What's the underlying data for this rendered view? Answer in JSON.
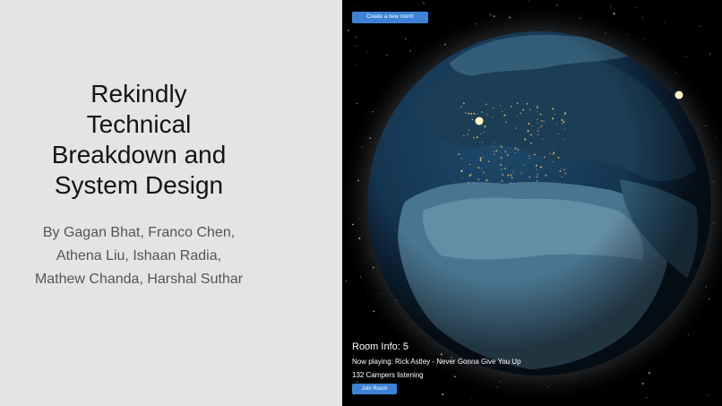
{
  "slide": {
    "title": "Rekindly\nTechnical\nBreakdown and\nSystem Design",
    "authors": "By Gagan Bhat, Franco Chen,\nAthena Liu, Ishaan Radia,\nMathew Chanda, Harshal Suthar"
  },
  "app": {
    "create_room_label": "Create a new room!",
    "room_info": "Room Info: 5",
    "now_playing": "Now playing: Rick Astley - Never Gonna Give You Up",
    "listeners": "132 Campers listening",
    "join_label": "Join Room"
  },
  "colors": {
    "left_bg": "#e4e4e4",
    "button_blue": "#3d82d6",
    "space": "#000000"
  }
}
